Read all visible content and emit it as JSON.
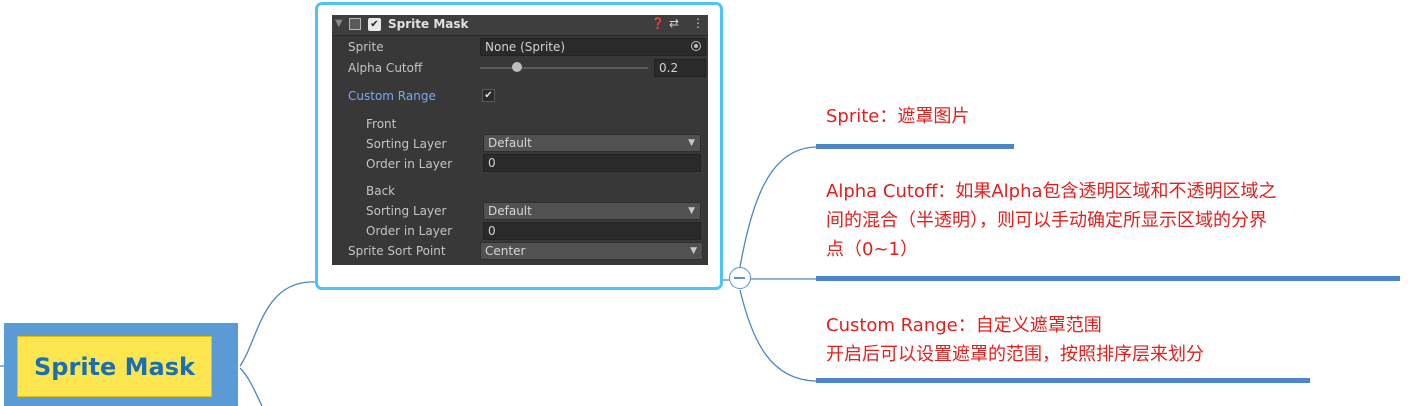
{
  "mindmap": {
    "root": {
      "label": "Sprite Mask"
    },
    "notes": [
      {
        "lines": [
          "Sprite：遮罩图片"
        ]
      },
      {
        "lines": [
          "Alpha Cutoff：如果Alpha包含透明区域和不透明区域之",
          "间的混合（半透明），则可以手动确定所显示区域的分界",
          "点（0~1）"
        ]
      },
      {
        "lines": [
          "Custom Range：自定义遮罩范围",
          "开启后可以设置遮罩的范围，按照排序层来划分"
        ]
      }
    ],
    "colors": {
      "note_text": "#e0201d",
      "root_fill": "#fde54f",
      "root_border": "#5b9bd5",
      "root_text": "#1a6fb0",
      "connector": "#4a86c8",
      "frame": "#4fc3f7"
    }
  },
  "inspector": {
    "title": "Sprite Mask",
    "header_icons": [
      "help-icon",
      "preset-icon",
      "menu-icon"
    ],
    "enabled": true,
    "sprite": {
      "label": "Sprite",
      "value": "None (Sprite)"
    },
    "alpha_cutoff": {
      "label": "Alpha Cutoff",
      "value": "0.2",
      "slider_fraction": 0.2
    },
    "custom_range": {
      "label": "Custom Range",
      "checked": true
    },
    "front": {
      "heading": "Front",
      "sorting_layer_label": "Sorting Layer",
      "sorting_layer_value": "Default",
      "order_label": "Order in Layer",
      "order_value": "0"
    },
    "back": {
      "heading": "Back",
      "sorting_layer_label": "Sorting Layer",
      "sorting_layer_value": "Default",
      "order_label": "Order in Layer",
      "order_value": "0"
    },
    "sprite_sort_point": {
      "label": "Sprite Sort Point",
      "value": "Center"
    }
  }
}
